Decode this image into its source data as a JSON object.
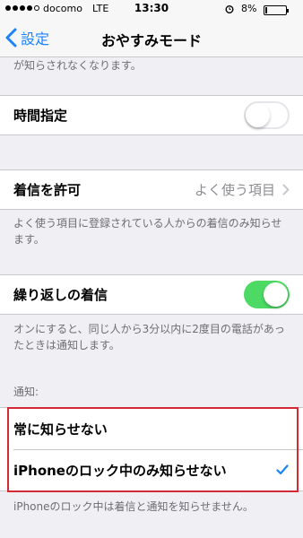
{
  "status_bar": {
    "carrier": "docomo",
    "network": "LTE",
    "time": "13:30",
    "battery_percent": "8%",
    "battery_level": 0.08,
    "signal_bars_filled": 4,
    "signal_bars_total": 5,
    "icons": [
      "alarm-icon",
      "battery-icon"
    ]
  },
  "nav": {
    "back_label": "設定",
    "title": "おやすみモード"
  },
  "content": {
    "top_footer": "が知らされなくなります。",
    "scheduled": {
      "label": "時間指定",
      "enabled": false
    },
    "allow_calls": {
      "label": "着信を許可",
      "value": "よく使う項目",
      "footer": "よく使う項目に登録されている人からの着信のみ知らせます。"
    },
    "repeated_calls": {
      "label": "繰り返しの着信",
      "enabled": true,
      "footer": "オンにすると、同じ人から3分以内に2度目の電話があったときは通知します。"
    },
    "silence": {
      "header": "通知:",
      "options": [
        {
          "label": "常に知らせない",
          "selected": false
        },
        {
          "label": "iPhoneのロック中のみ知らせない",
          "selected": true
        }
      ],
      "footer": "iPhoneのロック中は着信と通知を知らせません。"
    }
  },
  "colors": {
    "accent": "#1a82fb",
    "switch_on": "#4cd964",
    "highlight_border": "#d42a36",
    "background": "#efeff4"
  }
}
